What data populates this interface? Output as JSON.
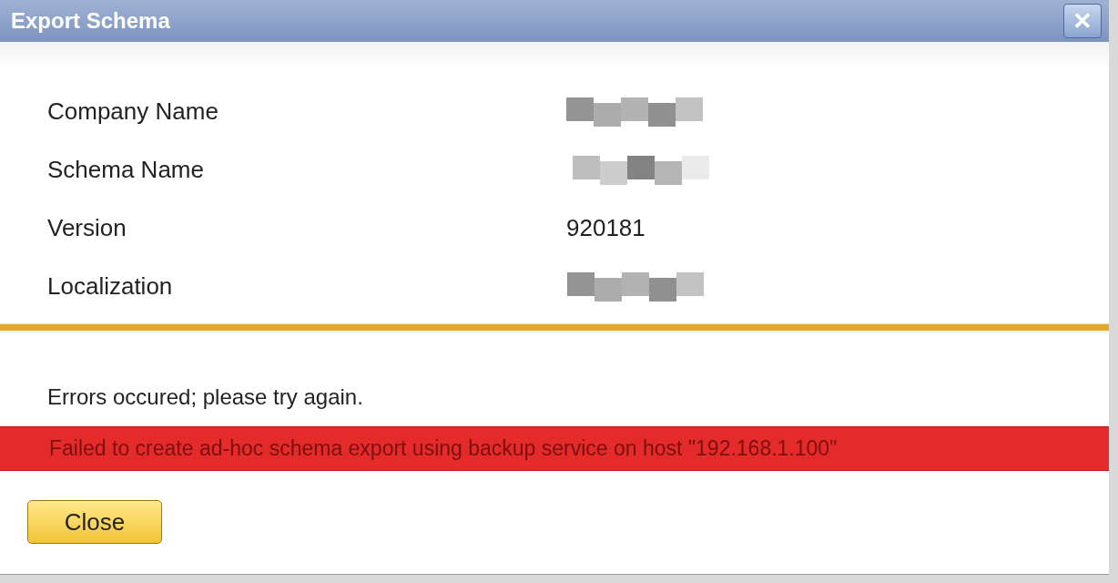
{
  "window": {
    "title": "Export Schema",
    "close_label": "✕"
  },
  "fields": [
    {
      "label": "Company Name",
      "redacted": true
    },
    {
      "label": "Schema Name",
      "redacted": true
    },
    {
      "label": "Version",
      "value": "920181",
      "redacted": false
    },
    {
      "label": "Localization",
      "redacted": true
    }
  ],
  "message": "Errors occured; please try again.",
  "error": "Failed to create ad-hoc schema export using backup service on host \"192.168.1.100\"",
  "buttons": [
    "Close"
  ]
}
